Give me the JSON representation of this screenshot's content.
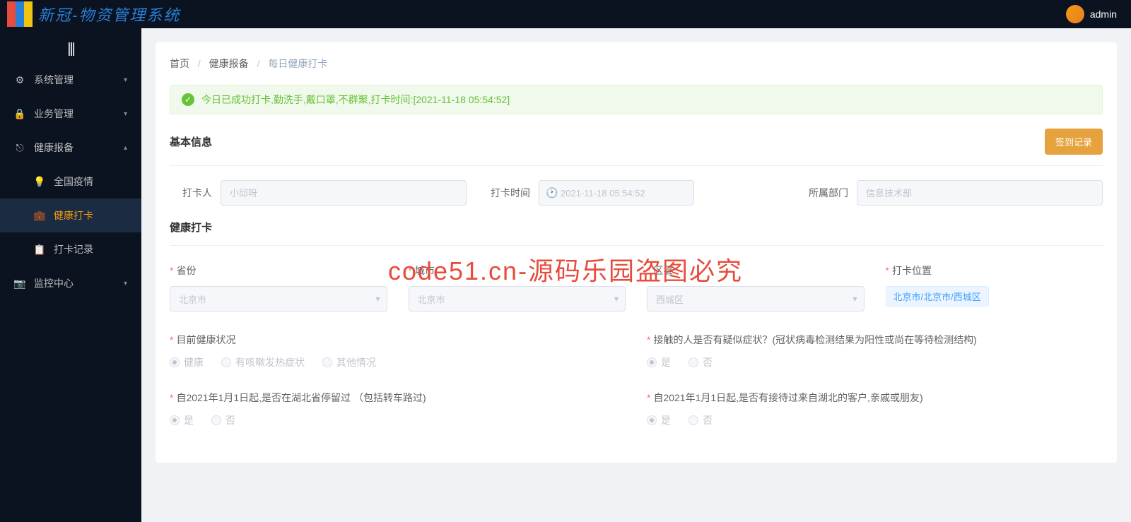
{
  "app": {
    "title": "新冠-物资管理系统"
  },
  "user": {
    "name": "admin"
  },
  "sidebar": {
    "items": [
      {
        "label": "系统管理",
        "icon": "⚙"
      },
      {
        "label": "业务管理",
        "icon": "🔒"
      },
      {
        "label": "健康报备",
        "icon": "⎋"
      },
      {
        "label": "监控中心",
        "icon": "📷"
      }
    ],
    "sub": [
      {
        "label": "全国疫情",
        "icon": "💡"
      },
      {
        "label": "健康打卡",
        "icon": "💼"
      },
      {
        "label": "打卡记录",
        "icon": "📋"
      }
    ]
  },
  "breadcrumb": {
    "a": "首页",
    "b": "健康报备",
    "c": "每日健康打卡"
  },
  "alert": {
    "text": "今日已成功打卡,勤洗手,戴口罩,不群聚,打卡时间:[2021-11-18 05:54:52]"
  },
  "section": {
    "basic": "基本信息",
    "health": "健康打卡",
    "signBtn": "签到记录"
  },
  "basic": {
    "person_label": "打卡人",
    "person_value": "小邱呀",
    "time_label": "打卡时间",
    "time_value": "2021-11-18 05:54:52",
    "dept_label": "所属部门",
    "dept_value": "信息技术部"
  },
  "fields": {
    "province_label": "省份",
    "province_value": "北京市",
    "city_label": "城市",
    "city_value": "北京市",
    "district_label": "区县",
    "district_value": "西城区",
    "location_label": "打卡位置",
    "location_value": "北京市/北京市/西城区",
    "health_label": "目前健康状况",
    "contact_label": "接触的人是否有疑似症状？(冠状病毒检测结果为阳性或尚在等待检测结构)",
    "hubei_stay_label": "自2021年1月1日起,是否在湖北省停留过 （包括转车路过)",
    "hubei_contact_label": "自2021年1月1日起,是否有接待过来自湖北的客户,亲戚或朋友)"
  },
  "radios": {
    "health": [
      "健康",
      "有咳嗽发热症状",
      "其他情况"
    ],
    "yesno": [
      "是",
      "否"
    ]
  },
  "watermark": "code51.cn-源码乐园盗图必究"
}
